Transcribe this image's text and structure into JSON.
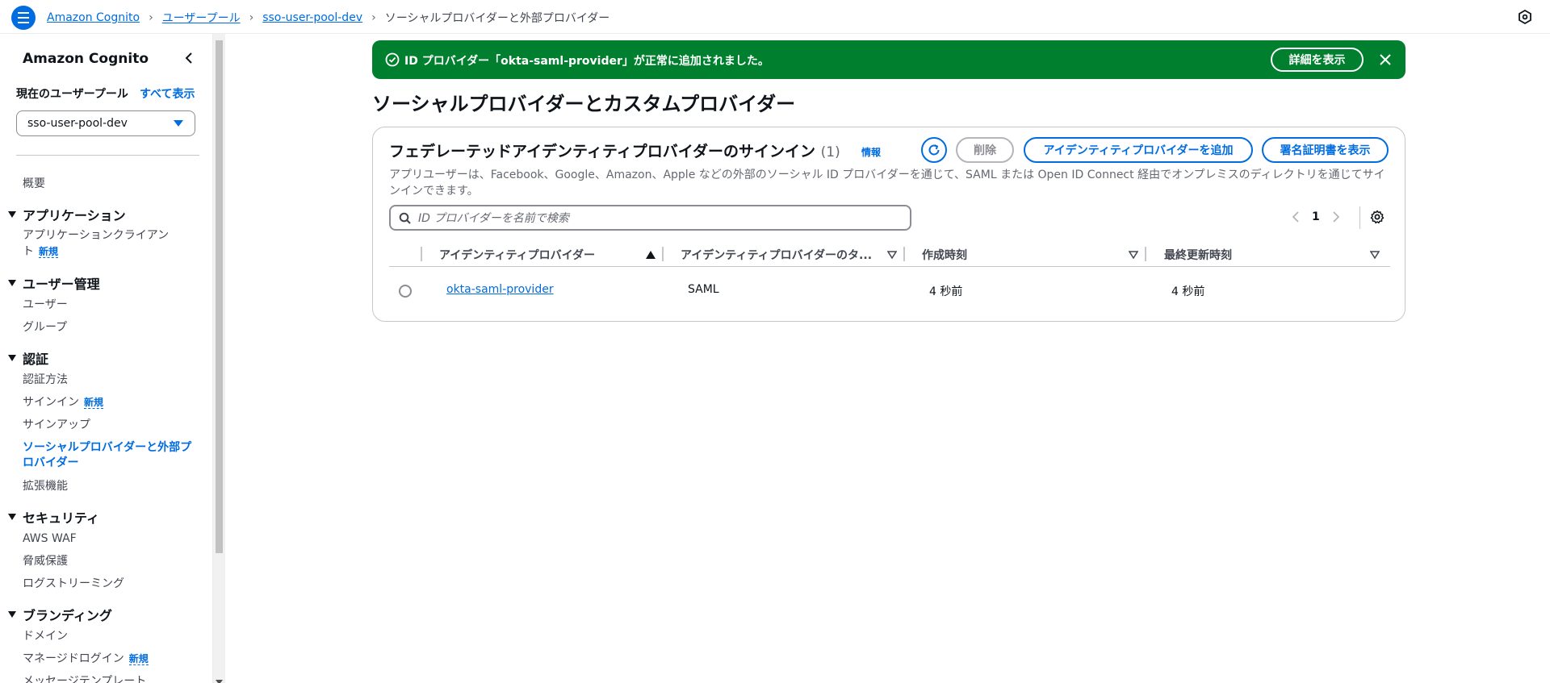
{
  "breadcrumbs": {
    "items": [
      "Amazon Cognito",
      "ユーザープール",
      "sso-user-pool-dev"
    ],
    "current": "ソーシャルプロバイダーと外部プロバイダー"
  },
  "sidebar": {
    "title": "Amazon Cognito",
    "pool_label": "現在のユーザープール",
    "view_all": "すべて表示",
    "selected_pool": "sso-user-pool-dev",
    "overview": "概要",
    "sections": {
      "applications": "アプリケーション",
      "user_management": "ユーザー管理",
      "auth": "認証",
      "security": "セキュリティ",
      "branding": "ブランディング"
    },
    "items": {
      "app_clients_line1": "アプリケーションクライアン",
      "app_clients_line2": "ト",
      "users": "ユーザー",
      "groups": "グループ",
      "auth_methods": "認証方法",
      "sign_in": "サインイン",
      "sign_up": "サインアップ",
      "social_line1": "ソーシャルプロバイダーと外部プ",
      "social_line2": "ロバイダー",
      "extensions": "拡張機能",
      "aws_waf": "AWS WAF",
      "threat_protection": "脅威保護",
      "log_streaming": "ログストリーミング",
      "domain": "ドメイン",
      "managed_login": "マネージドログイン",
      "message_templates": "メッセージテンプレート"
    },
    "new_badge": "新規"
  },
  "flash": {
    "message": "ID プロバイダー「okta-saml-provider」が正常に追加されました。",
    "details_button": "詳細を表示"
  },
  "page_title": "ソーシャルプロバイダーとカスタムプロバイダー",
  "container": {
    "title": "フェデレーテッドアイデンティティプロバイダーのサインイン",
    "count": "(1)",
    "info": "情報",
    "delete_button": "削除",
    "add_button": "アイデンティティプロバイダーを追加",
    "cert_button": "署名証明書を表示",
    "description": "アプリユーザーは、Facebook、Google、Amazon、Apple などの外部のソーシャル ID プロバイダーを通じて、SAML または Open ID Connect 経由でオンプレミスのディレクトリを通じてサインインできます。",
    "search_placeholder": "ID プロバイダーを名前で検索",
    "page_number": "1"
  },
  "table": {
    "headers": [
      "アイデンティティプロバイダー",
      "アイデンティティプロバイダーのタ...",
      "作成時刻",
      "最終更新時刻"
    ],
    "rows": [
      {
        "name": "okta-saml-provider",
        "type": "SAML",
        "created": "4 秒前",
        "updated": "4 秒前"
      }
    ]
  },
  "colors": {
    "accent": "#006ce0",
    "success": "#00802f"
  }
}
